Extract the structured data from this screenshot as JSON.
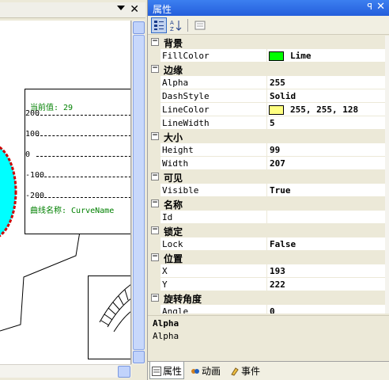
{
  "colors": {
    "title_bar": "#245edb",
    "ellipse_fill": "#00ffff",
    "ellipse_stroke": "#cc0000",
    "fill_lime": "#00ff00",
    "line_color": "#ffff80"
  },
  "canvas": {
    "curve": {
      "current_value_label": "当前值: 29",
      "axis_labels": [
        "200",
        "100",
        "0",
        "-100",
        "-200"
      ],
      "curve_name_label": "曲线名称: CurveName"
    }
  },
  "props_panel": {
    "title": "属性",
    "pin": "ꟼ",
    "close": "✕",
    "categorized_icon": "categorized-icon",
    "alphabetical_icon": "alphabetical-icon",
    "property_pages_icon": "property-pages-icon",
    "rows": [
      {
        "type": "cat",
        "label": "背景"
      },
      {
        "type": "prop",
        "name": "FillColor",
        "value": "Lime",
        "swatch": "#00ff00"
      },
      {
        "type": "cat",
        "label": "边缘"
      },
      {
        "type": "prop",
        "name": "Alpha",
        "value": "255"
      },
      {
        "type": "prop",
        "name": "DashStyle",
        "value": "Solid"
      },
      {
        "type": "prop",
        "name": "LineColor",
        "value": "255, 255, 128",
        "swatch": "#ffff80"
      },
      {
        "type": "prop",
        "name": "LineWidth",
        "value": "5"
      },
      {
        "type": "cat",
        "label": "大小"
      },
      {
        "type": "prop",
        "name": "Height",
        "value": "99"
      },
      {
        "type": "prop",
        "name": "Width",
        "value": "207"
      },
      {
        "type": "cat",
        "label": "可见"
      },
      {
        "type": "prop",
        "name": "Visible",
        "value": "True"
      },
      {
        "type": "cat",
        "label": "名称"
      },
      {
        "type": "prop",
        "name": "Id",
        "value": ""
      },
      {
        "type": "cat",
        "label": "锁定"
      },
      {
        "type": "prop",
        "name": "Lock",
        "value": "False"
      },
      {
        "type": "cat",
        "label": "位置"
      },
      {
        "type": "prop",
        "name": "X",
        "value": "193"
      },
      {
        "type": "prop",
        "name": "Y",
        "value": "222"
      },
      {
        "type": "cat",
        "label": "旋转角度"
      },
      {
        "type": "prop",
        "name": "Angle",
        "value": "0"
      }
    ],
    "description": {
      "title": "Alpha",
      "text": "Alpha"
    },
    "tabs": [
      {
        "label": "属性",
        "icon": "properties-icon",
        "active": true
      },
      {
        "label": "动画",
        "icon": "animation-icon",
        "active": false
      },
      {
        "label": "事件",
        "icon": "event-icon",
        "active": false
      }
    ]
  }
}
